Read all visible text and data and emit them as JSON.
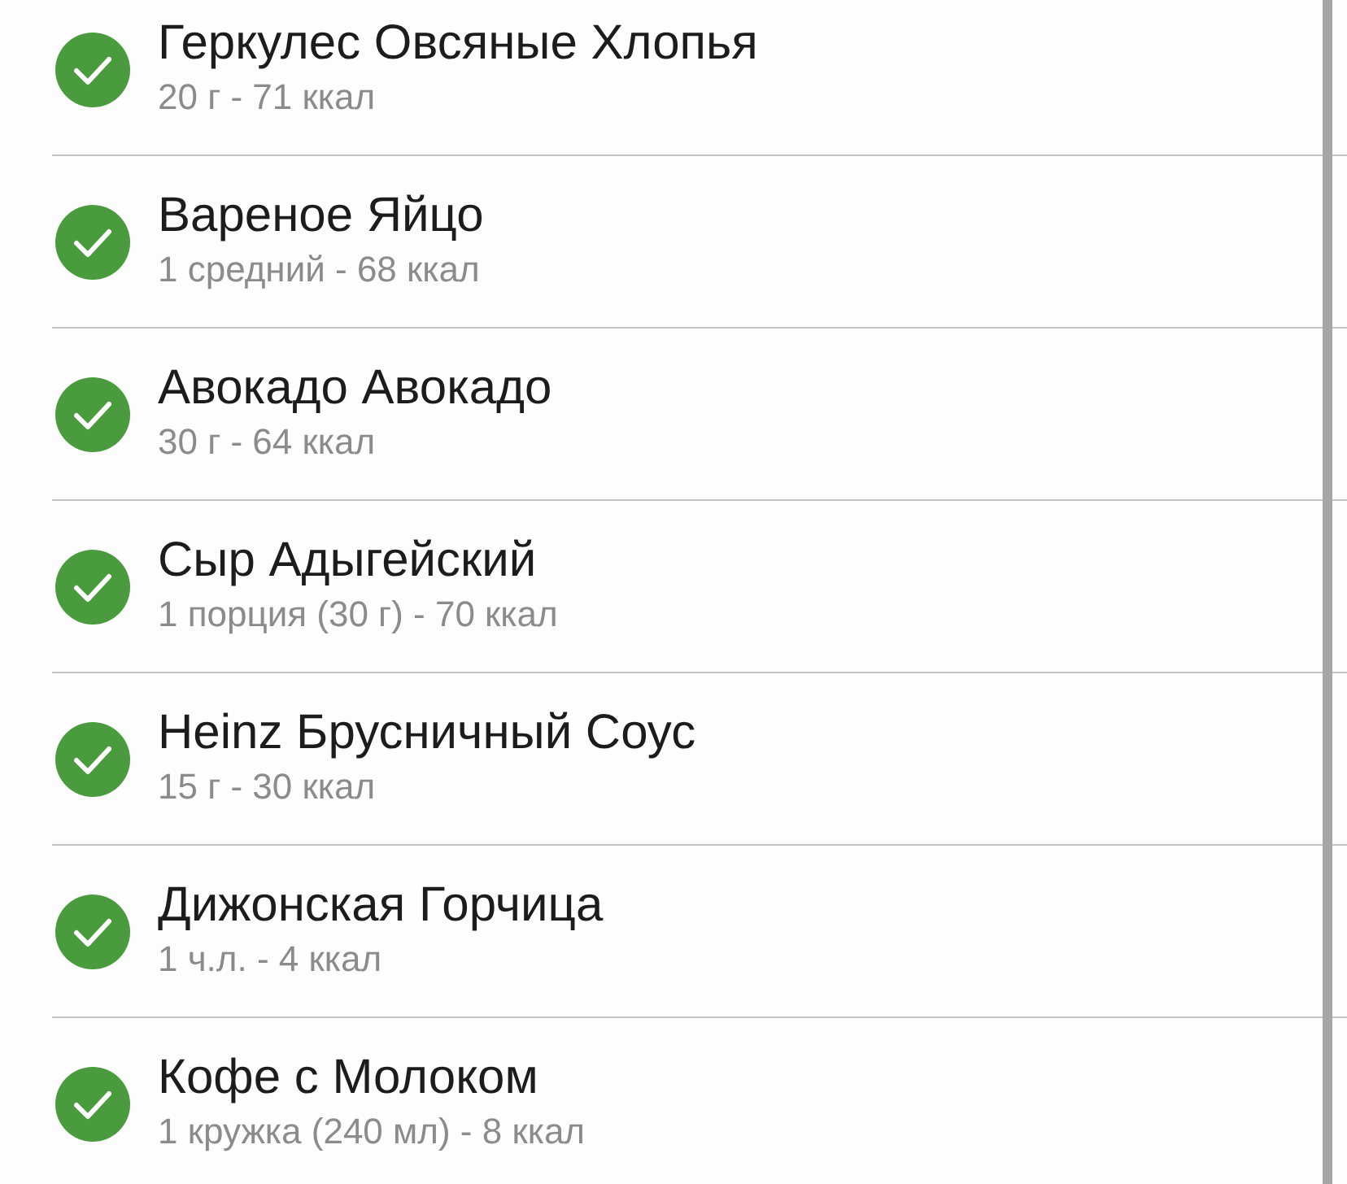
{
  "food_items": [
    {
      "name": "Геркулес Овсяные Хлопья",
      "detail": "20 г - 71 ккал",
      "checked": true
    },
    {
      "name": "Вареное Яйцо",
      "detail": "1 средний - 68 ккал",
      "checked": true
    },
    {
      "name": "Авокадо Авокадо",
      "detail": "30 г - 64 ккал",
      "checked": true
    },
    {
      "name": "Сыр Адыгейский",
      "detail": "1 порция (30 г) - 70 ккал",
      "checked": true
    },
    {
      "name": "Heinz Брусничный Соус",
      "detail": "15 г - 30 ккал",
      "checked": true
    },
    {
      "name": "Дижонская Горчица",
      "detail": "1 ч.л. - 4 ккал",
      "checked": true
    },
    {
      "name": "Кофе с Молоком",
      "detail": "1 кружка (240 мл) - 8 ккал",
      "checked": true
    }
  ]
}
